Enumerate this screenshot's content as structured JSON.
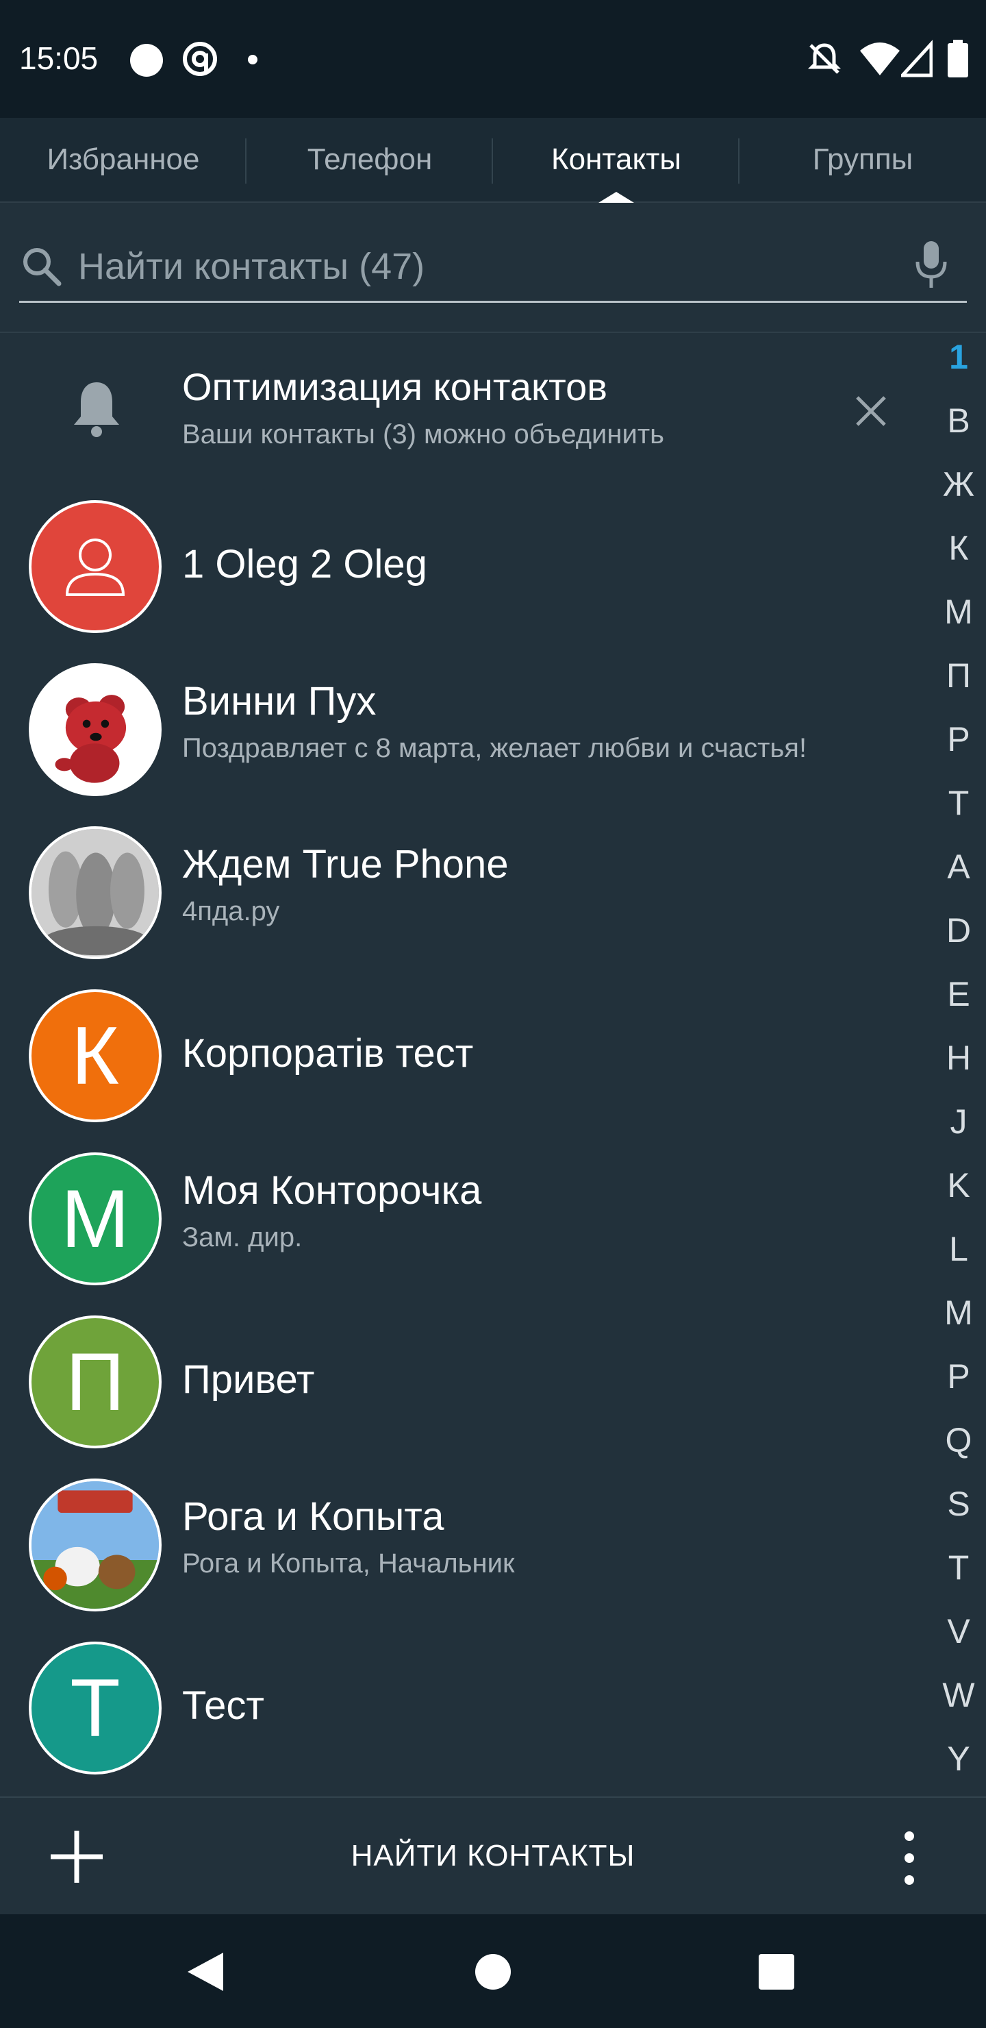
{
  "status_bar": {
    "time": "15:05"
  },
  "tabs": [
    {
      "label": "Избранное",
      "active": false
    },
    {
      "label": "Телефон",
      "active": false
    },
    {
      "label": "Контакты",
      "active": true
    },
    {
      "label": "Группы",
      "active": false
    }
  ],
  "search": {
    "placeholder": "Найти контакты (47)"
  },
  "notice": {
    "title": "Оптимизация контактов",
    "subtitle": "Ваши контакты (3) можно объединить"
  },
  "contacts": [
    {
      "name": "1 Oleg 2 Oleg",
      "subtitle": "",
      "avatar_type": "person-icon",
      "avatar_color": "#e0453b",
      "avatar_letter": ""
    },
    {
      "name": "Винни Пух",
      "subtitle": "Поздравляет с 8 марта, желает любви и счастья!",
      "avatar_type": "photo-bear",
      "avatar_color": "#ffffff",
      "avatar_letter": ""
    },
    {
      "name": "Ждем True Phone",
      "subtitle": "4пда.ру",
      "avatar_type": "photo-grey",
      "avatar_color": "#9a9a9a",
      "avatar_letter": ""
    },
    {
      "name": "Корпоратів тест",
      "subtitle": "",
      "avatar_type": "letter",
      "avatar_color": "#f06f0c",
      "avatar_letter": "К"
    },
    {
      "name": "Моя Конторочка",
      "subtitle": "Зам. дир.",
      "avatar_type": "letter",
      "avatar_color": "#1ea35a",
      "avatar_letter": "М"
    },
    {
      "name": "Привет",
      "subtitle": "",
      "avatar_type": "letter",
      "avatar_color": "#6fa33a",
      "avatar_letter": "П"
    },
    {
      "name": "Рога и Копыта",
      "subtitle": "Рога и Копыта, Начальник",
      "avatar_type": "photo-cartoon",
      "avatar_color": "#6aa6e0",
      "avatar_letter": ""
    },
    {
      "name": "Тест",
      "subtitle": "",
      "avatar_type": "letter",
      "avatar_color": "#15998a",
      "avatar_letter": "Т"
    }
  ],
  "alphabet_index": [
    "1",
    "В",
    "Ж",
    "К",
    "М",
    "П",
    "Р",
    "Т",
    "A",
    "D",
    "E",
    "H",
    "J",
    "K",
    "L",
    "M",
    "P",
    "Q",
    "S",
    "T",
    "V",
    "W",
    "Y"
  ],
  "alphabet_active": "1",
  "action_bar": {
    "find_label": "НАЙТИ КОНТАКТЫ"
  },
  "colors": {
    "background": "#22313b",
    "status_bar": "#0f1c25",
    "tab_bar": "#1b2a34",
    "accent": "#29a3e0"
  }
}
